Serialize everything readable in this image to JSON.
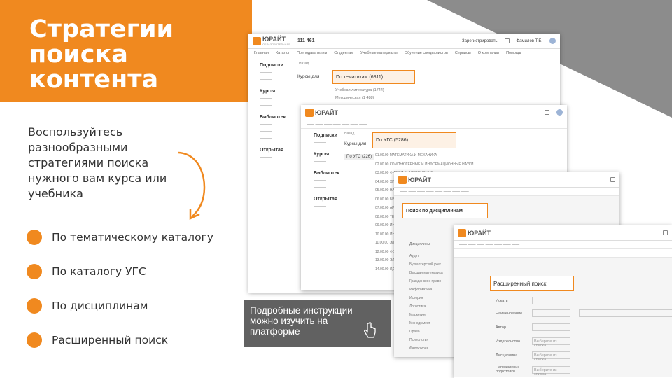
{
  "slide": {
    "title": "Стратегии\nпоиска\nконтента",
    "intro": "Воспользуйтесь\nразнообразными\nстратегиями поиска\nнужного вам курса или\nучебника",
    "bullets": [
      "По тематическому каталогу",
      "По каталогу УГС",
      "По дисциплинам",
      "Расширенный поиск"
    ],
    "note": "Подробные инструкции можно изучить на платформе",
    "colors": {
      "accent": "#f0891f",
      "gray": "#8c8c8c",
      "note_bg": "#616161"
    }
  },
  "screens": {
    "s1": {
      "logo": "ЮРАЙТ",
      "logo_sub": "ОБРАЗОВАТЕЛЬНАЯ",
      "stat": "111 461",
      "right_btn": "Зарегистрировать",
      "user": "Фамилов Т.Е.",
      "nav": [
        "Главная",
        "Каталог",
        "Преподавателям",
        "Студентам",
        "Учебные материалы",
        "Обучение специалистов",
        "Сервисы",
        "О компании",
        "Помощь"
      ],
      "side": [
        "Подписки",
        "Курсы",
        "Библиотек",
        "Открытая"
      ],
      "back": "Назад",
      "col_title": "Курсы для",
      "highlight": "По тематикам (6811)",
      "menu": [
        "Учебная литература (1744)",
        "Методическая (1 488)"
      ]
    },
    "s2": {
      "logo": "ЮРАЙТ",
      "side": [
        "Подписки",
        "Курсы",
        "Библиотек",
        "Открытая"
      ],
      "back": "Назад",
      "col_title": "Курсы для",
      "left_item": "По УГС (226)",
      "highlight": "По УГС (5286)",
      "menu": [
        "01.00.00 МАТЕМАТИКА И МЕХАНИКА",
        "02.00.00 КОМПЬЮТЕРНЫЕ И ИНФОРМАЦИОННЫЕ НАУКИ",
        "03.00.00 ФИЗИКА И АСТРОНОМИЯ",
        "04.00.00 ХИМИЯ",
        "05.00.00 НАУКИ О ЗЕМЛЕ",
        "06.00.00 БИОЛОГИЧЕСКИЕ НАУКИ",
        "07.00.00 АРХИТЕКТУРА",
        "08.00.00 ТЕХНИКА И ТЕХНОЛОГИИ СТРОИТЕЛЬСТВА",
        "09.00.00 ИНФОРМАТИКА",
        "10.00.00 ИНФОРМАЦИОННАЯ БЕЗОПАСНОСТЬ",
        "11.00.00 ЭЛЕКТРОНИКА",
        "12.00.00 ФОТОНИКА",
        "13.00.00 ЭЛЕКТРО- И ТЕПЛОЭНЕРГЕТИКА",
        "14.00.00 ЯДЕРНАЯ ЭНЕРГЕТИКА"
      ]
    },
    "s3": {
      "logo": "ЮРАЙТ",
      "highlight": "Поиск по дисциплинам",
      "tab": "Дисциплины",
      "rows": [
        "Аудит",
        "Бухгалтерский учет",
        "Высшая математика",
        "Гражданское право",
        "Информатика",
        "История",
        "Логистика",
        "Маркетинг",
        "Менеджмент",
        "Право",
        "Психология",
        "Философия"
      ]
    },
    "s4": {
      "logo": "ЮРАЙТ",
      "highlight": "Расширенный поиск",
      "labels": [
        "Искать",
        "Наименование",
        "Автор",
        "Издательство",
        "Дисциплина",
        "Направление подготовки"
      ],
      "placeholder": "Выберите из списка"
    }
  }
}
